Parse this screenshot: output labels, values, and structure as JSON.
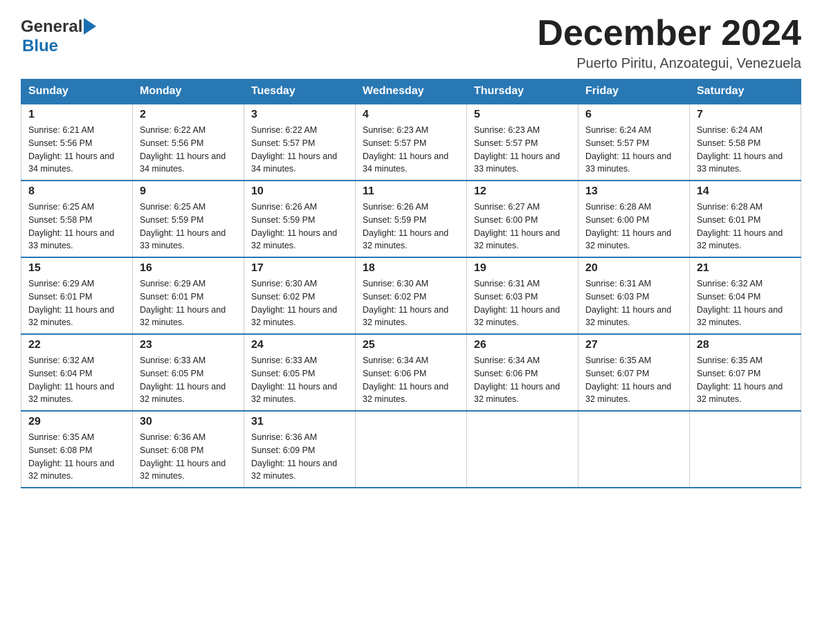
{
  "logo": {
    "general": "General",
    "blue": "Blue"
  },
  "title": "December 2024",
  "subtitle": "Puerto Piritu, Anzoategui, Venezuela",
  "weekdays": [
    "Sunday",
    "Monday",
    "Tuesday",
    "Wednesday",
    "Thursday",
    "Friday",
    "Saturday"
  ],
  "weeks": [
    [
      {
        "day": "1",
        "sunrise": "6:21 AM",
        "sunset": "5:56 PM",
        "daylight": "11 hours and 34 minutes."
      },
      {
        "day": "2",
        "sunrise": "6:22 AM",
        "sunset": "5:56 PM",
        "daylight": "11 hours and 34 minutes."
      },
      {
        "day": "3",
        "sunrise": "6:22 AM",
        "sunset": "5:57 PM",
        "daylight": "11 hours and 34 minutes."
      },
      {
        "day": "4",
        "sunrise": "6:23 AM",
        "sunset": "5:57 PM",
        "daylight": "11 hours and 34 minutes."
      },
      {
        "day": "5",
        "sunrise": "6:23 AM",
        "sunset": "5:57 PM",
        "daylight": "11 hours and 33 minutes."
      },
      {
        "day": "6",
        "sunrise": "6:24 AM",
        "sunset": "5:57 PM",
        "daylight": "11 hours and 33 minutes."
      },
      {
        "day": "7",
        "sunrise": "6:24 AM",
        "sunset": "5:58 PM",
        "daylight": "11 hours and 33 minutes."
      }
    ],
    [
      {
        "day": "8",
        "sunrise": "6:25 AM",
        "sunset": "5:58 PM",
        "daylight": "11 hours and 33 minutes."
      },
      {
        "day": "9",
        "sunrise": "6:25 AM",
        "sunset": "5:59 PM",
        "daylight": "11 hours and 33 minutes."
      },
      {
        "day": "10",
        "sunrise": "6:26 AM",
        "sunset": "5:59 PM",
        "daylight": "11 hours and 32 minutes."
      },
      {
        "day": "11",
        "sunrise": "6:26 AM",
        "sunset": "5:59 PM",
        "daylight": "11 hours and 32 minutes."
      },
      {
        "day": "12",
        "sunrise": "6:27 AM",
        "sunset": "6:00 PM",
        "daylight": "11 hours and 32 minutes."
      },
      {
        "day": "13",
        "sunrise": "6:28 AM",
        "sunset": "6:00 PM",
        "daylight": "11 hours and 32 minutes."
      },
      {
        "day": "14",
        "sunrise": "6:28 AM",
        "sunset": "6:01 PM",
        "daylight": "11 hours and 32 minutes."
      }
    ],
    [
      {
        "day": "15",
        "sunrise": "6:29 AM",
        "sunset": "6:01 PM",
        "daylight": "11 hours and 32 minutes."
      },
      {
        "day": "16",
        "sunrise": "6:29 AM",
        "sunset": "6:01 PM",
        "daylight": "11 hours and 32 minutes."
      },
      {
        "day": "17",
        "sunrise": "6:30 AM",
        "sunset": "6:02 PM",
        "daylight": "11 hours and 32 minutes."
      },
      {
        "day": "18",
        "sunrise": "6:30 AM",
        "sunset": "6:02 PM",
        "daylight": "11 hours and 32 minutes."
      },
      {
        "day": "19",
        "sunrise": "6:31 AM",
        "sunset": "6:03 PM",
        "daylight": "11 hours and 32 minutes."
      },
      {
        "day": "20",
        "sunrise": "6:31 AM",
        "sunset": "6:03 PM",
        "daylight": "11 hours and 32 minutes."
      },
      {
        "day": "21",
        "sunrise": "6:32 AM",
        "sunset": "6:04 PM",
        "daylight": "11 hours and 32 minutes."
      }
    ],
    [
      {
        "day": "22",
        "sunrise": "6:32 AM",
        "sunset": "6:04 PM",
        "daylight": "11 hours and 32 minutes."
      },
      {
        "day": "23",
        "sunrise": "6:33 AM",
        "sunset": "6:05 PM",
        "daylight": "11 hours and 32 minutes."
      },
      {
        "day": "24",
        "sunrise": "6:33 AM",
        "sunset": "6:05 PM",
        "daylight": "11 hours and 32 minutes."
      },
      {
        "day": "25",
        "sunrise": "6:34 AM",
        "sunset": "6:06 PM",
        "daylight": "11 hours and 32 minutes."
      },
      {
        "day": "26",
        "sunrise": "6:34 AM",
        "sunset": "6:06 PM",
        "daylight": "11 hours and 32 minutes."
      },
      {
        "day": "27",
        "sunrise": "6:35 AM",
        "sunset": "6:07 PM",
        "daylight": "11 hours and 32 minutes."
      },
      {
        "day": "28",
        "sunrise": "6:35 AM",
        "sunset": "6:07 PM",
        "daylight": "11 hours and 32 minutes."
      }
    ],
    [
      {
        "day": "29",
        "sunrise": "6:35 AM",
        "sunset": "6:08 PM",
        "daylight": "11 hours and 32 minutes."
      },
      {
        "day": "30",
        "sunrise": "6:36 AM",
        "sunset": "6:08 PM",
        "daylight": "11 hours and 32 minutes."
      },
      {
        "day": "31",
        "sunrise": "6:36 AM",
        "sunset": "6:09 PM",
        "daylight": "11 hours and 32 minutes."
      },
      null,
      null,
      null,
      null
    ]
  ],
  "colors": {
    "header_bg": "#2878b4",
    "header_text": "#ffffff",
    "border": "#cccccc",
    "text": "#222222"
  }
}
